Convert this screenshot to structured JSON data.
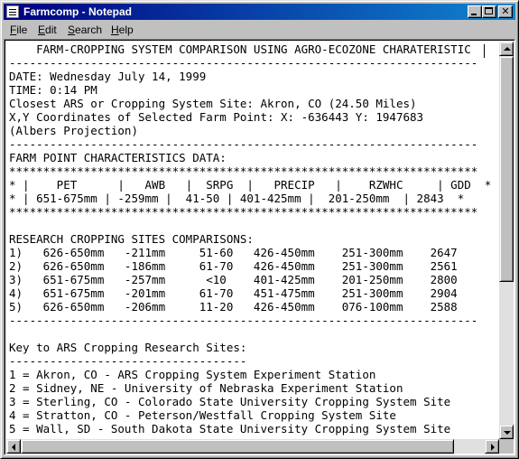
{
  "window": {
    "title": "Farmcomp - Notepad",
    "controls": {
      "minimize": "minimize",
      "maximize": "maximize",
      "close": "✕"
    }
  },
  "menu": [
    {
      "label": "File",
      "mnemonic": "F"
    },
    {
      "label": "Edit",
      "mnemonic": "E"
    },
    {
      "label": "Search",
      "mnemonic": "S"
    },
    {
      "label": "Help",
      "mnemonic": "H"
    }
  ],
  "document": {
    "lines": [
      "    FARM-CROPPING SYSTEM COMPARISON USING AGRO-ECOZONE CHARATERISTIC",
      "---------------------------------------------------------------------",
      "DATE: Wednesday July 14, 1999",
      "TIME: 0:14 PM",
      "Closest ARS or Cropping System Site: Akron, CO (24.50 Miles)",
      "X,Y Coordinates of Selected Farm Point: X: -636443 Y: 1947683",
      "(Albers Projection)",
      "---------------------------------------------------------------------",
      "FARM POINT CHARACTERISTICS DATA:",
      "*********************************************************************",
      "* |    PET      |   AWB   |  SRPG  |   PRECIP   |    RZWHC     | GDD  *",
      "* | 651-675mm | -259mm |  41-50 | 401-425mm |  201-250mm  | 2843  *",
      "*********************************************************************",
      "",
      "RESEARCH CROPPING SITES COMPARISONS:",
      "1)   626-650mm   -211mm     51-60   426-450mm    251-300mm    2647",
      "2)   626-650mm   -186mm     61-70   426-450mm    251-300mm    2561",
      "3)   651-675mm   -257mm      <10    401-425mm    201-250mm    2800",
      "4)   651-675mm   -201mm     61-70   451-475mm    251-300mm    2904",
      "5)   626-650mm   -206mm     11-20   426-450mm    076-100mm    2588",
      "---------------------------------------------------------------------",
      "",
      "Key to ARS Cropping Research Sites:",
      "-----------------------------------",
      "1 = Akron, CO - ARS Cropping System Experiment Station",
      "2 = Sidney, NE - University of Nebraska Experiment Station",
      "3 = Sterling, CO - Colorado State University Cropping System Site",
      "4 = Stratton, CO - Peterson/Westfall Cropping System Site",
      "5 = Wall, SD - South Dakota State University Cropping System Site"
    ]
  },
  "scroll": {
    "vertical_position": 0.0,
    "horizontal_position": 0.0
  },
  "colors": {
    "titlebar_start": "#000080",
    "titlebar_end": "#1084d0",
    "face": "#c0c0c0"
  }
}
